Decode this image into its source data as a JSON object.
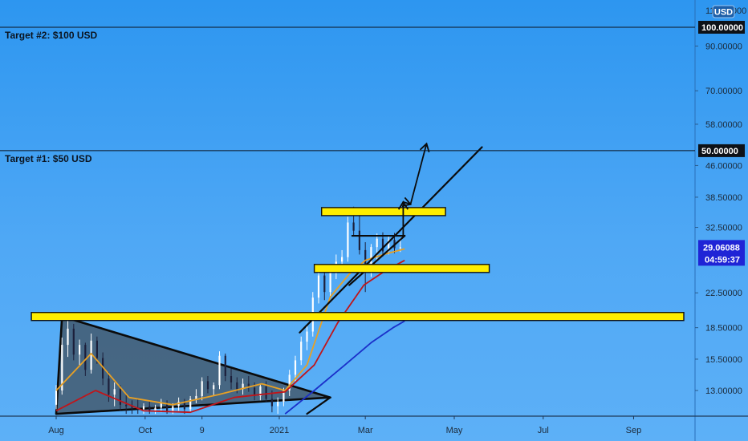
{
  "chart_data": {
    "type": "candlestick",
    "y_scale": "log",
    "ylim": [
      11.4,
      118
    ],
    "currency_button": "USD",
    "top_partial_tick": "110.00000",
    "y_ticks": [
      "100.00000",
      "90.00000",
      "70.00000",
      "58.00000",
      "50.00000",
      "46.00000",
      "38.50000",
      "32.50000",
      "29.06088",
      "22.50000",
      "18.50000",
      "15.50000",
      "13.00000"
    ],
    "x_ticks": [
      "Aug",
      "Oct",
      "9",
      "2021",
      "Mar",
      "May",
      "Jul",
      "Sep"
    ],
    "price_lines": [
      {
        "label": "Target #2: $100 USD",
        "value": 100,
        "tag": "100.00000"
      },
      {
        "label": "Target #1: $50 USD",
        "value": 50,
        "tag": "50.00000"
      }
    ],
    "current_price": {
      "value": 29.06088,
      "tag": "29.06088",
      "countdown": "04:59:37"
    },
    "support_zones": [
      {
        "value": 19.7,
        "range": [
          "2020-07-15",
          "2021-10-15"
        ]
      },
      {
        "value": 25.8,
        "range": [
          "2021-01-25",
          "2021-05-25"
        ]
      },
      {
        "value": 35.5,
        "range": [
          "2021-01-30",
          "2021-04-25"
        ]
      }
    ],
    "triangle": [
      [
        "2020-08-05",
        19.7
      ],
      [
        "2020-08-01",
        11.4
      ],
      [
        "2021-02-05",
        12.5
      ]
    ],
    "trendlines": [
      {
        "from": [
          "2021-01-20",
          11.4
        ],
        "to": [
          "2021-02-05",
          12.5
        ]
      },
      {
        "from": [
          "2021-01-15",
          18.0
        ],
        "to": [
          "2021-05-20",
          51
        ]
      },
      {
        "from": [
          "2021-02-18",
          23.5
        ],
        "to": [
          "2021-03-28",
          31
        ]
      },
      {
        "from": [
          "2021-02-20",
          31
        ],
        "to": [
          "2021-03-28",
          31
        ]
      }
    ],
    "projection_path": [
      [
        "2021-03-27",
        31
      ],
      [
        "2021-03-27",
        37.5
      ],
      [
        "2021-04-01",
        37
      ],
      [
        "2021-04-12",
        52
      ]
    ],
    "projection_arrowhead": [
      "2021-04-01",
      37
    ],
    "series": [
      {
        "name": "MA fast",
        "color": "#e8a024",
        "values": [
          [
            "2020-08-01",
            13
          ],
          [
            "2020-08-25",
            16
          ],
          [
            "2020-09-20",
            12.5
          ],
          [
            "2020-10-20",
            12
          ],
          [
            "2020-11-20",
            12.7
          ],
          [
            "2020-12-20",
            13.5
          ],
          [
            "2021-01-05",
            13
          ],
          [
            "2021-01-20",
            15
          ],
          [
            "2021-02-05",
            22
          ],
          [
            "2021-02-18",
            25
          ],
          [
            "2021-03-01",
            27
          ],
          [
            "2021-03-15",
            28
          ],
          [
            "2021-03-28",
            28.8
          ]
        ]
      },
      {
        "name": "MA medium",
        "color": "#c0151a",
        "values": [
          [
            "2020-08-01",
            11.6
          ],
          [
            "2020-08-28",
            13
          ],
          [
            "2020-09-30",
            11.6
          ],
          [
            "2020-11-01",
            11.5
          ],
          [
            "2020-12-01",
            12.5
          ],
          [
            "2021-01-05",
            12.9
          ],
          [
            "2021-01-25",
            15
          ],
          [
            "2021-02-10",
            19
          ],
          [
            "2021-02-28",
            23.5
          ],
          [
            "2021-03-15",
            25.5
          ],
          [
            "2021-03-28",
            27
          ]
        ]
      },
      {
        "name": "MA slow",
        "color": "#1b2fc9",
        "values": [
          [
            "2021-01-05",
            11.4
          ],
          [
            "2021-01-25",
            13
          ],
          [
            "2021-02-15",
            15
          ],
          [
            "2021-03-05",
            17
          ],
          [
            "2021-03-20",
            18.5
          ],
          [
            "2021-03-28",
            19.2
          ]
        ]
      }
    ],
    "candles": [
      [
        "2020-08-01",
        12.0,
        13.4,
        11.7,
        13.0
      ],
      [
        "2020-08-05",
        13.0,
        17.5,
        12.7,
        16.8
      ],
      [
        "2020-08-09",
        16.8,
        19.7,
        15.7,
        18.4
      ],
      [
        "2020-08-13",
        18.4,
        18.9,
        15.4,
        15.9
      ],
      [
        "2020-08-17",
        15.9,
        17.3,
        15.0,
        16.8
      ],
      [
        "2020-08-21",
        16.8,
        17.0,
        14.1,
        14.6
      ],
      [
        "2020-08-25",
        14.6,
        17.9,
        14.3,
        17.2
      ],
      [
        "2020-08-29",
        17.2,
        17.6,
        15.1,
        15.6
      ],
      [
        "2020-09-02",
        15.6,
        16.1,
        13.4,
        13.9
      ],
      [
        "2020-09-06",
        13.9,
        14.4,
        12.2,
        12.7
      ],
      [
        "2020-09-10",
        12.7,
        13.6,
        11.9,
        13.1
      ],
      [
        "2020-09-14",
        13.1,
        13.4,
        11.6,
        12.0
      ],
      [
        "2020-09-18",
        12.0,
        12.8,
        11.4,
        11.9
      ],
      [
        "2020-09-22",
        11.9,
        12.3,
        11.4,
        11.8
      ],
      [
        "2020-09-26",
        11.8,
        12.4,
        11.4,
        11.7
      ],
      [
        "2020-09-30",
        11.7,
        12.1,
        11.4,
        11.9
      ],
      [
        "2020-10-04",
        11.9,
        12.3,
        11.4,
        11.6
      ],
      [
        "2020-10-08",
        11.6,
        12.0,
        11.4,
        11.8
      ],
      [
        "2020-10-12",
        11.8,
        12.4,
        11.5,
        12.1
      ],
      [
        "2020-10-16",
        12.1,
        12.3,
        11.4,
        11.6
      ],
      [
        "2020-10-20",
        11.6,
        12.1,
        11.4,
        11.9
      ],
      [
        "2020-10-24",
        11.9,
        12.5,
        11.6,
        12.2
      ],
      [
        "2020-10-28",
        12.2,
        12.4,
        11.4,
        11.7
      ],
      [
        "2020-11-01",
        11.7,
        12.6,
        11.5,
        12.4
      ],
      [
        "2020-11-05",
        12.4,
        13.1,
        12.1,
        12.6
      ],
      [
        "2020-11-09",
        12.6,
        14.0,
        12.3,
        13.7
      ],
      [
        "2020-11-13",
        13.7,
        14.1,
        12.8,
        13.1
      ],
      [
        "2020-11-17",
        13.1,
        13.6,
        12.6,
        13.4
      ],
      [
        "2020-11-21",
        13.4,
        16.2,
        13.1,
        15.8
      ],
      [
        "2020-11-25",
        15.8,
        16.0,
        13.7,
        14.1
      ],
      [
        "2020-11-29",
        14.1,
        14.7,
        13.1,
        13.6
      ],
      [
        "2020-12-03",
        13.6,
        14.0,
        12.8,
        13.1
      ],
      [
        "2020-12-07",
        13.1,
        13.9,
        12.7,
        13.5
      ],
      [
        "2020-12-11",
        13.5,
        14.1,
        12.9,
        13.2
      ],
      [
        "2020-12-15",
        13.2,
        13.6,
        12.3,
        12.6
      ],
      [
        "2020-12-19",
        12.6,
        13.5,
        12.3,
        13.3
      ],
      [
        "2020-12-23",
        13.3,
        13.7,
        12.2,
        12.4
      ],
      [
        "2020-12-27",
        12.4,
        13.0,
        11.5,
        11.9
      ],
      [
        "2020-12-31",
        11.9,
        12.5,
        11.4,
        12.2
      ],
      [
        "2021-01-04",
        12.2,
        13.2,
        11.9,
        13.0
      ],
      [
        "2021-01-08",
        13.0,
        14.6,
        12.6,
        14.2
      ],
      [
        "2021-01-12",
        14.2,
        15.8,
        13.7,
        15.4
      ],
      [
        "2021-01-16",
        15.4,
        17.6,
        15.0,
        17.1
      ],
      [
        "2021-01-20",
        17.1,
        18.7,
        16.3,
        18.1
      ],
      [
        "2021-01-24",
        18.1,
        22.6,
        17.6,
        21.9
      ],
      [
        "2021-01-28",
        21.9,
        25.6,
        21.2,
        24.8
      ],
      [
        "2021-02-01",
        24.8,
        25.4,
        21.6,
        22.6
      ],
      [
        "2021-02-05",
        22.6,
        26.2,
        22.1,
        25.5
      ],
      [
        "2021-02-09",
        25.5,
        27.9,
        24.3,
        26.8
      ],
      [
        "2021-02-13",
        26.8,
        28.6,
        25.3,
        27.5
      ],
      [
        "2021-02-17",
        27.5,
        34.5,
        26.8,
        33.4
      ],
      [
        "2021-02-21",
        33.4,
        36.5,
        30.9,
        31.9
      ],
      [
        "2021-02-25",
        31.9,
        34.9,
        27.9,
        28.6
      ],
      [
        "2021-03-01",
        28.6,
        29.9,
        22.6,
        25.3
      ],
      [
        "2021-03-05",
        25.3,
        29.6,
        24.6,
        29.1
      ],
      [
        "2021-03-09",
        29.1,
        31.4,
        27.1,
        30.5
      ],
      [
        "2021-03-13",
        30.5,
        31.6,
        27.6,
        28.4
      ],
      [
        "2021-03-17",
        28.4,
        31.1,
        27.9,
        30.3
      ],
      [
        "2021-03-21",
        30.3,
        31.5,
        28.1,
        28.9
      ],
      [
        "2021-03-25",
        28.9,
        30.6,
        28.3,
        29.06
      ]
    ]
  }
}
